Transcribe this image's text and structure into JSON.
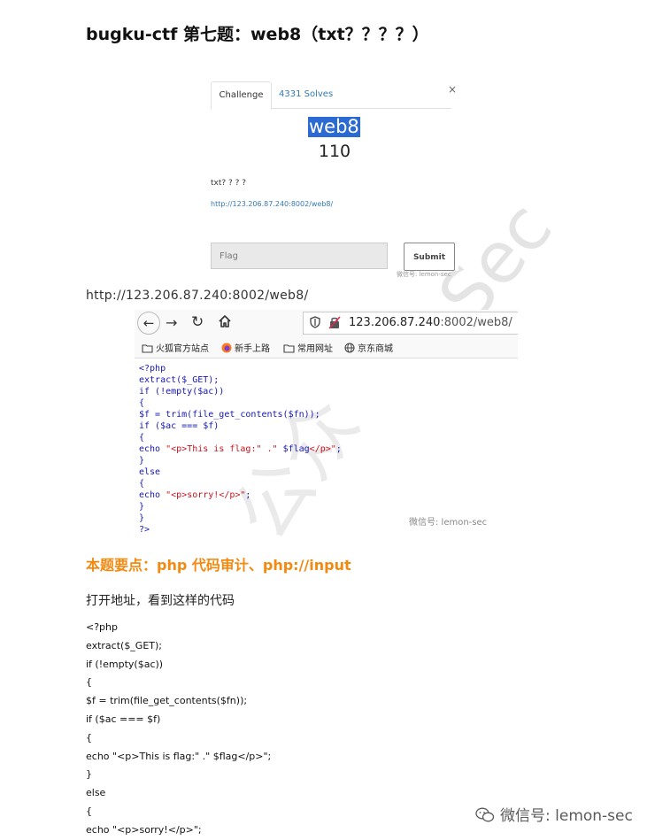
{
  "article": {
    "title": "bugku-ctf 第七题：web8（txt？？？？）",
    "url_line": "http://123.206.87.240:8002/web8/",
    "key_point": "本题要点：php 代码审计、php://input",
    "intro": "打开地址，看到这样的代码",
    "code_lines": [
      "<?php",
      "extract($_GET);",
      "if (!empty($ac))",
      "{",
      "$f = trim(file_get_contents($fn));",
      "if ($ac === $f)",
      "{",
      "echo \"<p>This is flag:\" .\" $flag</p>\";",
      "}",
      "else",
      "{",
      "echo \"<p>sorry!</p>\";"
    ]
  },
  "challenge_modal": {
    "tabs": [
      "Challenge",
      "4331 Solves"
    ],
    "close": "×",
    "name": "web8",
    "points": "110",
    "description": "txt? ? ? ?",
    "link": "http://123.206.87.240:8002/web8/",
    "flag_placeholder": "Flag",
    "submit_label": "Submit"
  },
  "browser": {
    "url_host": "123.206.87.240",
    "url_path": ":8002/web8/",
    "bookmarks": [
      "火狐官方站点",
      "新手上路",
      "常用网址",
      "京东商城"
    ],
    "code": [
      [
        {
          "t": "<?php",
          "c": "blue"
        }
      ],
      [
        {
          "t": "extract($_GET);",
          "c": "blue"
        }
      ],
      [
        {
          "t": "if (!empty($ac))",
          "c": "blue"
        }
      ],
      [
        {
          "t": "{",
          "c": "blue"
        }
      ],
      [
        {
          "t": "$f = trim(file_get_contents($fn));",
          "c": "blue"
        }
      ],
      [
        {
          "t": "if ($ac === $f)",
          "c": "blue"
        }
      ],
      [
        {
          "t": "{",
          "c": "blue"
        }
      ],
      [
        {
          "t": "echo ",
          "c": "blue"
        },
        {
          "t": "\"<p>This is flag:\" .\" ",
          "c": "red"
        },
        {
          "t": "$flag",
          "c": "blue"
        },
        {
          "t": "</p>\"",
          "c": "red"
        },
        {
          "t": ";",
          "c": "blue"
        }
      ],
      [
        {
          "t": "}",
          "c": "blue"
        }
      ],
      [
        {
          "t": "else",
          "c": "blue"
        }
      ],
      [
        {
          "t": "{",
          "c": "blue"
        }
      ],
      [
        {
          "t": "echo ",
          "c": "blue"
        },
        {
          "t": "\"<p>sorry!</p>\"",
          "c": "red"
        },
        {
          "t": ";",
          "c": "blue"
        }
      ],
      [
        {
          "t": "}",
          "c": "blue"
        }
      ],
      [
        {
          "t": "}",
          "c": "blue"
        }
      ],
      [
        {
          "t": "?>",
          "c": "blue"
        }
      ]
    ]
  },
  "watermarks": {
    "small": "微信号: lemon-sec",
    "browser": "微信号: lemon-sec",
    "bottom": "微信号: lemon-sec",
    "background_1": "公众",
    "background_2": "nSec"
  },
  "colors": {
    "accent_orange": "#f28a12",
    "link_blue": "#337ab7",
    "code_blue": "#1616b8",
    "code_red": "#c8141e",
    "highlight": "#2a6ad2"
  }
}
